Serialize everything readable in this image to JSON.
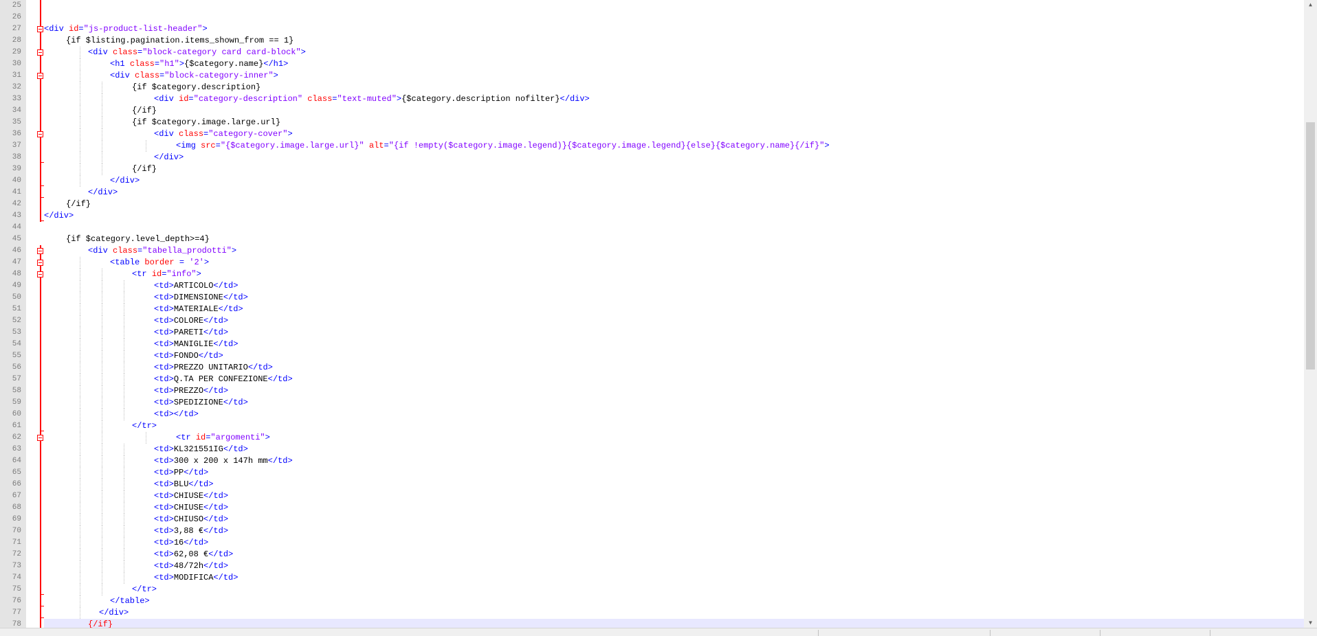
{
  "editor": {
    "first_line": 25,
    "current_line": 78,
    "colors": {
      "tag": "#0000ff",
      "attribute": "#ff0000",
      "string": "#8000ff",
      "text": "#000000",
      "fold_marker": "#ff0000",
      "current_line_bg": "#e8e8ff",
      "gutter_bg": "#e4e4e4"
    },
    "lines": [
      {
        "n": "25",
        "fold": "line",
        "indent": 0,
        "guides": [],
        "tokens": []
      },
      {
        "n": "26",
        "fold": "line",
        "indent": 0,
        "guides": [],
        "tokens": []
      },
      {
        "n": "27",
        "fold": "open",
        "indent": 0,
        "guides": [],
        "tokens": [
          [
            "tag",
            "<div "
          ],
          [
            "attr",
            "id"
          ],
          [
            "tag",
            "="
          ],
          [
            "str",
            "\"js-product-list-header\""
          ],
          [
            "tag",
            ">"
          ]
        ]
      },
      {
        "n": "28",
        "fold": "line",
        "indent": 1,
        "guides": [],
        "tokens": [
          [
            "txt",
            "{if $listing.pagination.items_shown_from == 1}"
          ]
        ]
      },
      {
        "n": "29",
        "fold": "open",
        "indent": 2,
        "guides": [
          2
        ],
        "tokens": [
          [
            "tag",
            "<div "
          ],
          [
            "attr",
            "class"
          ],
          [
            "tag",
            "="
          ],
          [
            "str",
            "\"block-category card card-block\""
          ],
          [
            "tag",
            ">"
          ]
        ]
      },
      {
        "n": "30",
        "fold": "line",
        "indent": 3,
        "guides": [
          2
        ],
        "tokens": [
          [
            "tag",
            "<h1 "
          ],
          [
            "attr",
            "class"
          ],
          [
            "tag",
            "="
          ],
          [
            "str",
            "\"h1\""
          ],
          [
            "tag",
            ">"
          ],
          [
            "txt",
            "{$category.name}"
          ],
          [
            "tag",
            "</h1>"
          ]
        ]
      },
      {
        "n": "31",
        "fold": "open",
        "indent": 3,
        "guides": [
          2
        ],
        "tokens": [
          [
            "tag",
            "<div "
          ],
          [
            "attr",
            "class"
          ],
          [
            "tag",
            "="
          ],
          [
            "str",
            "\"block-category-inner\""
          ],
          [
            "tag",
            ">"
          ]
        ]
      },
      {
        "n": "32",
        "fold": "line",
        "indent": 4,
        "guides": [
          2,
          3
        ],
        "tokens": [
          [
            "txt",
            "{if $category.description}"
          ]
        ]
      },
      {
        "n": "33",
        "fold": "line",
        "indent": 5,
        "guides": [
          2,
          3
        ],
        "tokens": [
          [
            "tag",
            "<div "
          ],
          [
            "attr",
            "id"
          ],
          [
            "tag",
            "="
          ],
          [
            "str",
            "\"category-description\" "
          ],
          [
            "attr",
            "class"
          ],
          [
            "tag",
            "="
          ],
          [
            "str",
            "\"text-muted\""
          ],
          [
            "tag",
            ">"
          ],
          [
            "txt",
            "{$category.description nofilter}"
          ],
          [
            "tag",
            "</div>"
          ]
        ]
      },
      {
        "n": "34",
        "fold": "line",
        "indent": 4,
        "guides": [
          2,
          3
        ],
        "tokens": [
          [
            "txt",
            "{/if}"
          ]
        ]
      },
      {
        "n": "35",
        "fold": "line",
        "indent": 4,
        "guides": [
          2,
          3
        ],
        "tokens": [
          [
            "txt",
            "{if $category.image.large.url}"
          ]
        ]
      },
      {
        "n": "36",
        "fold": "open",
        "indent": 5,
        "guides": [
          2,
          3
        ],
        "tokens": [
          [
            "tag",
            "<div "
          ],
          [
            "attr",
            "class"
          ],
          [
            "tag",
            "="
          ],
          [
            "str",
            "\"category-cover\""
          ],
          [
            "tag",
            ">"
          ]
        ]
      },
      {
        "n": "37",
        "fold": "line",
        "indent": 6,
        "guides": [
          2,
          3,
          5
        ],
        "tokens": [
          [
            "tag",
            "<img "
          ],
          [
            "attr",
            "src"
          ],
          [
            "tag",
            "="
          ],
          [
            "str",
            "\"{$category.image.large.url}\" "
          ],
          [
            "attr",
            "alt"
          ],
          [
            "tag",
            "="
          ],
          [
            "str",
            "\"{if !empty($category.image.legend)}{$category.image.legend}{else}{$category.name}{/if}\""
          ],
          [
            "tag",
            ">"
          ]
        ]
      },
      {
        "n": "38",
        "fold": "end",
        "indent": 5,
        "guides": [
          2,
          3
        ],
        "tokens": [
          [
            "tag",
            "</div>"
          ]
        ]
      },
      {
        "n": "39",
        "fold": "line",
        "indent": 4,
        "guides": [
          2,
          3
        ],
        "tokens": [
          [
            "txt",
            "{/if}"
          ]
        ]
      },
      {
        "n": "40",
        "fold": "end",
        "indent": 3,
        "guides": [
          2
        ],
        "tokens": [
          [
            "tag",
            "</div>"
          ]
        ]
      },
      {
        "n": "41",
        "fold": "end",
        "indent": 2,
        "guides": [],
        "tokens": [
          [
            "tag",
            "</div>"
          ]
        ]
      },
      {
        "n": "42",
        "fold": "line",
        "indent": 1,
        "guides": [],
        "tokens": [
          [
            "txt",
            "{/if}"
          ]
        ]
      },
      {
        "n": "43",
        "fold": "end",
        "indent": 0,
        "guides": [],
        "tokens": [
          [
            "tag",
            "</div>"
          ]
        ]
      },
      {
        "n": "44",
        "fold": "none",
        "indent": 0,
        "guides": [],
        "tokens": []
      },
      {
        "n": "45",
        "fold": "none",
        "indent": 1,
        "guides": [],
        "tokens": [
          [
            "txt",
            "{if $category.level_depth>=4}"
          ]
        ]
      },
      {
        "n": "46",
        "fold": "open",
        "indent": 2,
        "guides": [],
        "tokens": [
          [
            "tag",
            "<div "
          ],
          [
            "attr",
            "class"
          ],
          [
            "tag",
            "="
          ],
          [
            "str",
            "\"tabella_prodotti\""
          ],
          [
            "tag",
            ">"
          ]
        ]
      },
      {
        "n": "47",
        "fold": "open",
        "indent": 3,
        "guides": [
          2
        ],
        "tokens": [
          [
            "tag",
            "<table "
          ],
          [
            "attr",
            "border"
          ],
          [
            "tag",
            " = "
          ],
          [
            "str",
            "'2'"
          ],
          [
            "tag",
            ">"
          ]
        ]
      },
      {
        "n": "48",
        "fold": "open",
        "indent": 4,
        "guides": [
          2,
          3
        ],
        "tokens": [
          [
            "tag",
            "<tr "
          ],
          [
            "attr",
            "id"
          ],
          [
            "tag",
            "="
          ],
          [
            "str",
            "\"info\""
          ],
          [
            "tag",
            ">"
          ]
        ]
      },
      {
        "n": "49",
        "fold": "line",
        "indent": 5,
        "guides": [
          2,
          3,
          4
        ],
        "tokens": [
          [
            "tag",
            "<td>"
          ],
          [
            "txt",
            "ARTICOLO"
          ],
          [
            "tag",
            "</td>"
          ]
        ]
      },
      {
        "n": "50",
        "fold": "line",
        "indent": 5,
        "guides": [
          2,
          3,
          4
        ],
        "tokens": [
          [
            "tag",
            "<td>"
          ],
          [
            "txt",
            "DIMENSIONE"
          ],
          [
            "tag",
            "</td>"
          ]
        ]
      },
      {
        "n": "51",
        "fold": "line",
        "indent": 5,
        "guides": [
          2,
          3,
          4
        ],
        "tokens": [
          [
            "tag",
            "<td>"
          ],
          [
            "txt",
            "MATERIALE"
          ],
          [
            "tag",
            "</td>"
          ]
        ]
      },
      {
        "n": "52",
        "fold": "line",
        "indent": 5,
        "guides": [
          2,
          3,
          4
        ],
        "tokens": [
          [
            "tag",
            "<td>"
          ],
          [
            "txt",
            "COLORE"
          ],
          [
            "tag",
            "</td>"
          ]
        ]
      },
      {
        "n": "53",
        "fold": "line",
        "indent": 5,
        "guides": [
          2,
          3,
          4
        ],
        "tokens": [
          [
            "tag",
            "<td>"
          ],
          [
            "txt",
            "PARETI"
          ],
          [
            "tag",
            "</td>"
          ]
        ]
      },
      {
        "n": "54",
        "fold": "line",
        "indent": 5,
        "guides": [
          2,
          3,
          4
        ],
        "tokens": [
          [
            "tag",
            "<td>"
          ],
          [
            "txt",
            "MANIGLIE"
          ],
          [
            "tag",
            "</td>"
          ]
        ]
      },
      {
        "n": "55",
        "fold": "line",
        "indent": 5,
        "guides": [
          2,
          3,
          4
        ],
        "tokens": [
          [
            "tag",
            "<td>"
          ],
          [
            "txt",
            "FONDO"
          ],
          [
            "tag",
            "</td>"
          ]
        ]
      },
      {
        "n": "56",
        "fold": "line",
        "indent": 5,
        "guides": [
          2,
          3,
          4
        ],
        "tokens": [
          [
            "tag",
            "<td>"
          ],
          [
            "txt",
            "PREZZO UNITARIO"
          ],
          [
            "tag",
            "</td>"
          ]
        ]
      },
      {
        "n": "57",
        "fold": "line",
        "indent": 5,
        "guides": [
          2,
          3,
          4
        ],
        "tokens": [
          [
            "tag",
            "<td>"
          ],
          [
            "txt",
            "Q.TA PER CONFEZIONE"
          ],
          [
            "tag",
            "</td>"
          ]
        ]
      },
      {
        "n": "58",
        "fold": "line",
        "indent": 5,
        "guides": [
          2,
          3,
          4
        ],
        "tokens": [
          [
            "tag",
            "<td>"
          ],
          [
            "txt",
            "PREZZO"
          ],
          [
            "tag",
            "</td>"
          ]
        ]
      },
      {
        "n": "59",
        "fold": "line",
        "indent": 5,
        "guides": [
          2,
          3,
          4
        ],
        "tokens": [
          [
            "tag",
            "<td>"
          ],
          [
            "txt",
            "SPEDIZIONE"
          ],
          [
            "tag",
            "</td>"
          ]
        ]
      },
      {
        "n": "60",
        "fold": "line",
        "indent": 5,
        "guides": [
          2,
          3,
          4
        ],
        "tokens": [
          [
            "tag",
            "<td></td>"
          ]
        ]
      },
      {
        "n": "61",
        "fold": "end",
        "indent": 4,
        "guides": [
          2,
          3
        ],
        "tokens": [
          [
            "tag",
            "</tr>"
          ]
        ]
      },
      {
        "n": "62",
        "fold": "open",
        "indent": 6,
        "guides": [
          2,
          3,
          5
        ],
        "tokens": [
          [
            "tag",
            "<tr "
          ],
          [
            "attr",
            "id"
          ],
          [
            "tag",
            "="
          ],
          [
            "str",
            "\"argomenti\""
          ],
          [
            "tag",
            ">"
          ]
        ]
      },
      {
        "n": "63",
        "fold": "line",
        "indent": 5,
        "guides": [
          2,
          3,
          4
        ],
        "tokens": [
          [
            "tag",
            "<td>"
          ],
          [
            "txt",
            "KL321551IG"
          ],
          [
            "tag",
            "</td>"
          ]
        ]
      },
      {
        "n": "64",
        "fold": "line",
        "indent": 5,
        "guides": [
          2,
          3,
          4
        ],
        "tokens": [
          [
            "tag",
            "<td>"
          ],
          [
            "txt",
            "300 x 200 x 147h mm"
          ],
          [
            "tag",
            "</td>"
          ]
        ]
      },
      {
        "n": "65",
        "fold": "line",
        "indent": 5,
        "guides": [
          2,
          3,
          4
        ],
        "tokens": [
          [
            "tag",
            "<td>"
          ],
          [
            "txt",
            "PP"
          ],
          [
            "tag",
            "</td>"
          ]
        ]
      },
      {
        "n": "66",
        "fold": "line",
        "indent": 5,
        "guides": [
          2,
          3,
          4
        ],
        "tokens": [
          [
            "tag",
            "<td>"
          ],
          [
            "txt",
            "BLU"
          ],
          [
            "tag",
            "</td>"
          ]
        ]
      },
      {
        "n": "67",
        "fold": "line",
        "indent": 5,
        "guides": [
          2,
          3,
          4
        ],
        "tokens": [
          [
            "tag",
            "<td>"
          ],
          [
            "txt",
            "CHIUSE"
          ],
          [
            "tag",
            "</td>"
          ]
        ]
      },
      {
        "n": "68",
        "fold": "line",
        "indent": 5,
        "guides": [
          2,
          3,
          4
        ],
        "tokens": [
          [
            "tag",
            "<td>"
          ],
          [
            "txt",
            "CHIUSE"
          ],
          [
            "tag",
            "</td>"
          ]
        ]
      },
      {
        "n": "69",
        "fold": "line",
        "indent": 5,
        "guides": [
          2,
          3,
          4
        ],
        "tokens": [
          [
            "tag",
            "<td>"
          ],
          [
            "txt",
            "CHIUSO"
          ],
          [
            "tag",
            "</td>"
          ]
        ]
      },
      {
        "n": "70",
        "fold": "line",
        "indent": 5,
        "guides": [
          2,
          3,
          4
        ],
        "tokens": [
          [
            "tag",
            "<td>"
          ],
          [
            "txt",
            "3,88 €"
          ],
          [
            "tag",
            "</td>"
          ]
        ]
      },
      {
        "n": "71",
        "fold": "line",
        "indent": 5,
        "guides": [
          2,
          3,
          4
        ],
        "tokens": [
          [
            "tag",
            "<td>"
          ],
          [
            "txt",
            "16"
          ],
          [
            "tag",
            "</td>"
          ]
        ]
      },
      {
        "n": "72",
        "fold": "line",
        "indent": 5,
        "guides": [
          2,
          3,
          4
        ],
        "tokens": [
          [
            "tag",
            "<td>"
          ],
          [
            "txt",
            "62,08 €"
          ],
          [
            "tag",
            "</td>"
          ]
        ]
      },
      {
        "n": "73",
        "fold": "line",
        "indent": 5,
        "guides": [
          2,
          3,
          4
        ],
        "tokens": [
          [
            "tag",
            "<td>"
          ],
          [
            "txt",
            "48/72h"
          ],
          [
            "tag",
            "</td>"
          ]
        ]
      },
      {
        "n": "74",
        "fold": "line",
        "indent": 5,
        "guides": [
          2,
          3,
          4
        ],
        "tokens": [
          [
            "tag",
            "<td>"
          ],
          [
            "txt",
            "MODIFICA"
          ],
          [
            "tag",
            "</td>"
          ]
        ]
      },
      {
        "n": "75",
        "fold": "end",
        "indent": 4,
        "guides": [
          2,
          3
        ],
        "tokens": [
          [
            "tag",
            "</tr>"
          ]
        ]
      },
      {
        "n": "76",
        "fold": "end",
        "indent": 3,
        "guides": [
          2
        ],
        "tokens": [
          [
            "tag",
            "</table>"
          ]
        ]
      },
      {
        "n": "77",
        "fold": "end",
        "indent": 2.5,
        "guides": [
          2
        ],
        "tokens": [
          [
            "tag",
            "</div>"
          ]
        ]
      },
      {
        "n": "78",
        "fold": "end",
        "indent": 2,
        "guides": [],
        "tokens": [
          [
            "red",
            "{/if}"
          ]
        ],
        "current": true
      }
    ]
  },
  "scrollbar": {
    "up_icon": "up-arrow-icon",
    "down_icon": "down-arrow-icon"
  }
}
